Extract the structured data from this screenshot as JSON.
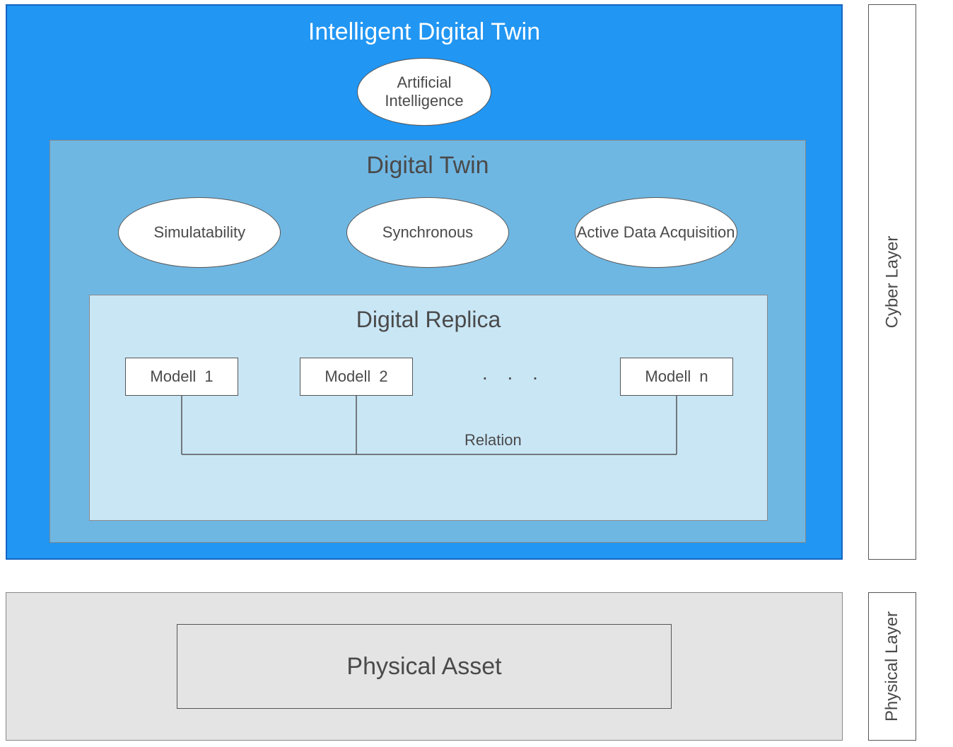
{
  "idt": {
    "title": "Intelligent Digital Twin",
    "ai": "Artificial Intelligence"
  },
  "dt": {
    "title": "Digital Twin",
    "props": [
      "Simulatability",
      "Synchronous",
      "Active Data Acquisition"
    ]
  },
  "dr": {
    "title": "Digital Replica",
    "models": {
      "m1": "Modell 1",
      "m2": "Modell 2",
      "mn": "Modell n",
      "dots": ". . ."
    },
    "relation": "Relation"
  },
  "physical": {
    "asset": "Physical Asset"
  },
  "layers": {
    "cyber": "Cyber Layer",
    "physical": "Physical Layer"
  }
}
